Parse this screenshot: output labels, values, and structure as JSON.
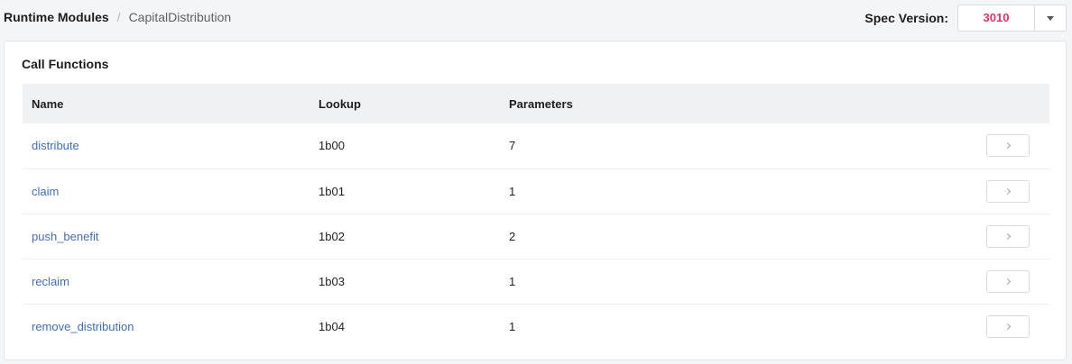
{
  "breadcrumb": {
    "root": "Runtime Modules",
    "separator": "/",
    "current": "CapitalDistribution"
  },
  "spec": {
    "label": "Spec Version:",
    "value": "3010"
  },
  "card": {
    "title": "Call Functions"
  },
  "table": {
    "headers": [
      "Name",
      "Lookup",
      "Parameters"
    ],
    "rows": [
      {
        "name": "distribute",
        "lookup": "1b00",
        "parameters": "7"
      },
      {
        "name": "claim",
        "lookup": "1b01",
        "parameters": "1"
      },
      {
        "name": "push_benefit",
        "lookup": "1b02",
        "parameters": "2"
      },
      {
        "name": "reclaim",
        "lookup": "1b03",
        "parameters": "1"
      },
      {
        "name": "remove_distribution",
        "lookup": "1b04",
        "parameters": "1"
      }
    ]
  },
  "colors": {
    "link": "#3f6ec6",
    "spec_value": "#e6315f"
  }
}
